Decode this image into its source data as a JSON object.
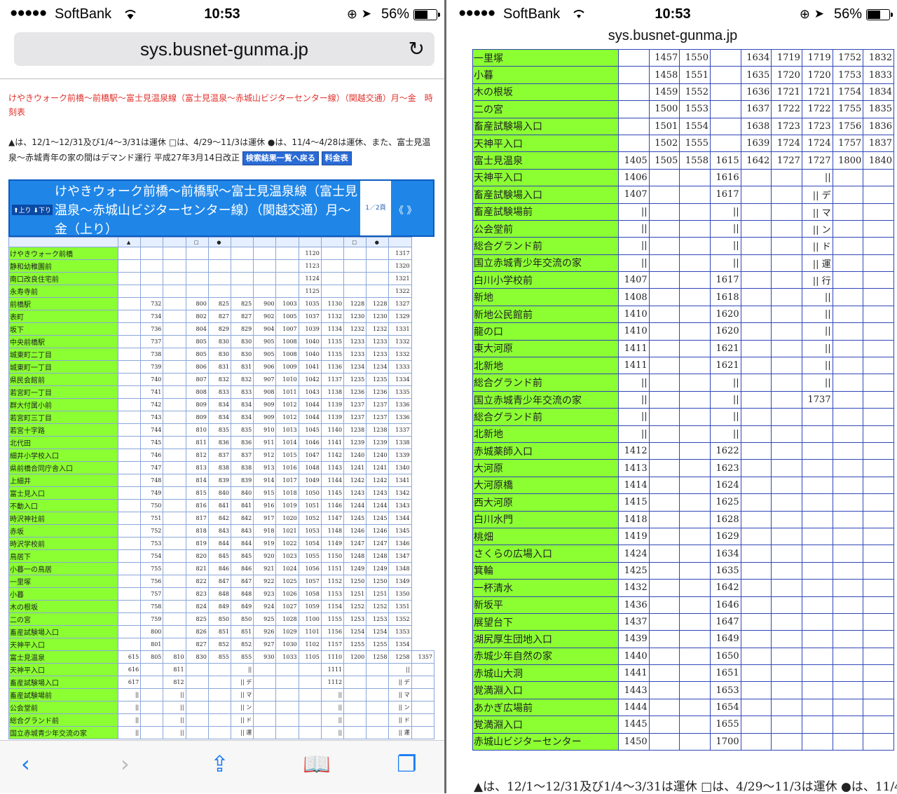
{
  "status": {
    "carrier": "SoftBank",
    "signal": "●●●●●",
    "time": "10:53",
    "battery": "56%"
  },
  "browser": {
    "url": "sys.busnet-gunma.jp"
  },
  "route_title": "けやきウォーク前橋〜前橋駅〜富士見温泉線（富士見温泉〜赤城山ビジターセンター線）（関越交通）月〜金　時刻表",
  "note_text": "▲は、12/1〜12/31及び1/4〜3/31は運休 □は、4/29〜11/3は運休 ●は、11/4〜4/28は運休、また、富士見温泉〜赤城青年の家の間はデマンド運行 平成27年3月14日改正",
  "buttons": {
    "back_results": "検索結果一覧へ戻る",
    "fare": "料金表"
  },
  "banner": {
    "up": "⬆上り",
    "down": "⬇下り",
    "title": "けやきウォーク前橋〜前橋駅〜富士見温泉線（富士見温泉〜赤城山ビジターセンター線）（関越交通）月〜金（上り）",
    "page": "1／2頁",
    "prev": "《",
    "next": "》"
  },
  "left_header": [
    "",
    "▲",
    "",
    "",
    "□",
    "●",
    "",
    "",
    "",
    "",
    "",
    "□",
    "●",
    ""
  ],
  "left_rows": [
    [
      "けやきウォーク前橋",
      "",
      "",
      "",
      "",
      "",
      "",
      "",
      "",
      "1120",
      "",
      "",
      "",
      "1317"
    ],
    [
      "静和幼稚園前",
      "",
      "",
      "",
      "",
      "",
      "",
      "",
      "",
      "1123",
      "",
      "",
      "",
      "1320"
    ],
    [
      "南口改良住宅前",
      "",
      "",
      "",
      "",
      "",
      "",
      "",
      "",
      "1124",
      "",
      "",
      "",
      "1321"
    ],
    [
      "永寿寺前",
      "",
      "",
      "",
      "",
      "",
      "",
      "",
      "",
      "1125",
      "",
      "",
      "",
      "1322"
    ],
    [
      "前橋駅",
      "",
      "732",
      "",
      "800",
      "825",
      "825",
      "900",
      "1003",
      "1035",
      "1130",
      "1228",
      "1228",
      "1327"
    ],
    [
      "表町",
      "",
      "734",
      "",
      "802",
      "827",
      "827",
      "902",
      "1005",
      "1037",
      "1132",
      "1230",
      "1230",
      "1329"
    ],
    [
      "坂下",
      "",
      "736",
      "",
      "804",
      "829",
      "829",
      "904",
      "1007",
      "1039",
      "1134",
      "1232",
      "1232",
      "1331"
    ],
    [
      "中央前橋駅",
      "",
      "737",
      "",
      "805",
      "830",
      "830",
      "905",
      "1008",
      "1040",
      "1135",
      "1233",
      "1233",
      "1332"
    ],
    [
      "城東町二丁目",
      "",
      "738",
      "",
      "805",
      "830",
      "830",
      "905",
      "1008",
      "1040",
      "1135",
      "1233",
      "1233",
      "1332"
    ],
    [
      "城東町一丁目",
      "",
      "739",
      "",
      "806",
      "831",
      "831",
      "906",
      "1009",
      "1041",
      "1136",
      "1234",
      "1234",
      "1333"
    ],
    [
      "県民会館前",
      "",
      "740",
      "",
      "807",
      "832",
      "832",
      "907",
      "1010",
      "1042",
      "1137",
      "1235",
      "1235",
      "1334"
    ],
    [
      "若宮町一丁目",
      "",
      "741",
      "",
      "808",
      "833",
      "833",
      "908",
      "1011",
      "1043",
      "1138",
      "1236",
      "1236",
      "1335"
    ],
    [
      "群大付属小前",
      "",
      "742",
      "",
      "809",
      "834",
      "834",
      "909",
      "1012",
      "1044",
      "1139",
      "1237",
      "1237",
      "1336"
    ],
    [
      "若宮町三丁目",
      "",
      "743",
      "",
      "809",
      "834",
      "834",
      "909",
      "1012",
      "1044",
      "1139",
      "1237",
      "1237",
      "1336"
    ],
    [
      "若宮十字路",
      "",
      "744",
      "",
      "810",
      "835",
      "835",
      "910",
      "1013",
      "1045",
      "1140",
      "1238",
      "1238",
      "1337"
    ],
    [
      "北代田",
      "",
      "745",
      "",
      "811",
      "836",
      "836",
      "911",
      "1014",
      "1046",
      "1141",
      "1239",
      "1239",
      "1338"
    ],
    [
      "細井小学校入口",
      "",
      "746",
      "",
      "812",
      "837",
      "837",
      "912",
      "1015",
      "1047",
      "1142",
      "1240",
      "1240",
      "1339"
    ],
    [
      "県前橋合同庁舎入口",
      "",
      "747",
      "",
      "813",
      "838",
      "838",
      "913",
      "1016",
      "1048",
      "1143",
      "1241",
      "1241",
      "1340"
    ],
    [
      "上細井",
      "",
      "748",
      "",
      "814",
      "839",
      "839",
      "914",
      "1017",
      "1049",
      "1144",
      "1242",
      "1242",
      "1341"
    ],
    [
      "富士見入口",
      "",
      "749",
      "",
      "815",
      "840",
      "840",
      "915",
      "1018",
      "1050",
      "1145",
      "1243",
      "1243",
      "1342"
    ],
    [
      "不動入口",
      "",
      "750",
      "",
      "816",
      "841",
      "841",
      "916",
      "1019",
      "1051",
      "1146",
      "1244",
      "1244",
      "1343"
    ],
    [
      "時沢神社前",
      "",
      "751",
      "",
      "817",
      "842",
      "842",
      "917",
      "1020",
      "1052",
      "1147",
      "1245",
      "1245",
      "1344"
    ],
    [
      "赤坂",
      "",
      "752",
      "",
      "818",
      "843",
      "843",
      "918",
      "1021",
      "1053",
      "1148",
      "1246",
      "1246",
      "1345"
    ],
    [
      "時沢学校前",
      "",
      "753",
      "",
      "819",
      "844",
      "844",
      "919",
      "1022",
      "1054",
      "1149",
      "1247",
      "1247",
      "1346"
    ],
    [
      "鳥居下",
      "",
      "754",
      "",
      "820",
      "845",
      "845",
      "920",
      "1023",
      "1055",
      "1150",
      "1248",
      "1248",
      "1347"
    ],
    [
      "小暮一の鳥居",
      "",
      "755",
      "",
      "821",
      "846",
      "846",
      "921",
      "1024",
      "1056",
      "1151",
      "1249",
      "1249",
      "1348"
    ],
    [
      "一里塚",
      "",
      "756",
      "",
      "822",
      "847",
      "847",
      "922",
      "1025",
      "1057",
      "1152",
      "1250",
      "1250",
      "1349"
    ],
    [
      "小暮",
      "",
      "757",
      "",
      "823",
      "848",
      "848",
      "923",
      "1026",
      "1058",
      "1153",
      "1251",
      "1251",
      "1350"
    ],
    [
      "木の根坂",
      "",
      "758",
      "",
      "824",
      "849",
      "849",
      "924",
      "1027",
      "1059",
      "1154",
      "1252",
      "1252",
      "1351"
    ],
    [
      "二の宮",
      "",
      "759",
      "",
      "825",
      "850",
      "850",
      "925",
      "1028",
      "1100",
      "1155",
      "1253",
      "1253",
      "1352"
    ],
    [
      "畜産試験場入口",
      "",
      "800",
      "",
      "826",
      "851",
      "851",
      "926",
      "1029",
      "1101",
      "1156",
      "1254",
      "1254",
      "1353"
    ],
    [
      "天神平入口",
      "",
      "801",
      "",
      "827",
      "852",
      "852",
      "927",
      "1030",
      "1102",
      "1157",
      "1255",
      "1255",
      "1354"
    ],
    [
      "富士見温泉",
      "615",
      "805",
      "810",
      "830",
      "855",
      "855",
      "930",
      "1033",
      "1105",
      "1110",
      "1200",
      "1258",
      "1258",
      "1357"
    ],
    [
      "天神平入口",
      "616",
      "",
      "811",
      "",
      "",
      "||",
      "",
      "",
      "",
      "1111",
      "",
      "",
      "||",
      ""
    ],
    [
      "畜産試験場入口",
      "617",
      "",
      "812",
      "",
      "",
      "|| デ",
      "",
      "",
      "",
      "1112",
      "",
      "",
      "|| デ",
      ""
    ],
    [
      "畜産試験場前",
      "||",
      "",
      "||",
      "",
      "",
      "|| マ",
      "",
      "",
      "",
      "||",
      "",
      "",
      "|| マ",
      ""
    ],
    [
      "公会堂前",
      "||",
      "",
      "||",
      "",
      "",
      "|| ン",
      "",
      "",
      "",
      "||",
      "",
      "",
      "|| ン",
      ""
    ],
    [
      "総合グランド前",
      "||",
      "",
      "||",
      "",
      "",
      "|| ド",
      "",
      "",
      "",
      "||",
      "",
      "",
      "|| ド",
      ""
    ],
    [
      "国立赤城青少年交流の家",
      "||",
      "",
      "||",
      "",
      "",
      "|| 運",
      "",
      "",
      "",
      "||",
      "",
      "",
      "|| 運",
      ""
    ]
  ],
  "right_rows": [
    [
      "一里塚",
      "",
      "1457",
      "1550",
      "",
      "1634",
      "1719",
      "1719",
      "1752",
      "1832"
    ],
    [
      "小暮",
      "",
      "1458",
      "1551",
      "",
      "1635",
      "1720",
      "1720",
      "1753",
      "1833"
    ],
    [
      "木の根坂",
      "",
      "1459",
      "1552",
      "",
      "1636",
      "1721",
      "1721",
      "1754",
      "1834"
    ],
    [
      "二の宮",
      "",
      "1500",
      "1553",
      "",
      "1637",
      "1722",
      "1722",
      "1755",
      "1835"
    ],
    [
      "畜産試験場入口",
      "",
      "1501",
      "1554",
      "",
      "1638",
      "1723",
      "1723",
      "1756",
      "1836"
    ],
    [
      "天神平入口",
      "",
      "1502",
      "1555",
      "",
      "1639",
      "1724",
      "1724",
      "1757",
      "1837"
    ],
    [
      "富士見温泉",
      "1405",
      "1505",
      "1558",
      "1615",
      "1642",
      "1727",
      "1727",
      "1800",
      "1840"
    ],
    [
      "天神平入口",
      "1406",
      "",
      "",
      "1616",
      "",
      "",
      "||",
      "",
      ""
    ],
    [
      "畜産試験場入口",
      "1407",
      "",
      "",
      "1617",
      "",
      "",
      "|| デ",
      "",
      ""
    ],
    [
      "畜産試験場前",
      "||",
      "",
      "",
      "||",
      "",
      "",
      "|| マ",
      "",
      ""
    ],
    [
      "公会堂前",
      "||",
      "",
      "",
      "||",
      "",
      "",
      "|| ン",
      "",
      ""
    ],
    [
      "総合グランド前",
      "||",
      "",
      "",
      "||",
      "",
      "",
      "|| ド",
      "",
      ""
    ],
    [
      "国立赤城青少年交流の家",
      "||",
      "",
      "",
      "||",
      "",
      "",
      "|| 運",
      "",
      ""
    ],
    [
      "白川小学校前",
      "1407",
      "",
      "",
      "1617",
      "",
      "",
      "|| 行",
      "",
      ""
    ],
    [
      "新地",
      "1408",
      "",
      "",
      "1618",
      "",
      "",
      "||",
      "",
      ""
    ],
    [
      "新地公民館前",
      "1410",
      "",
      "",
      "1620",
      "",
      "",
      "||",
      "",
      ""
    ],
    [
      "龍の口",
      "1410",
      "",
      "",
      "1620",
      "",
      "",
      "||",
      "",
      ""
    ],
    [
      "東大河原",
      "1411",
      "",
      "",
      "1621",
      "",
      "",
      "||",
      "",
      ""
    ],
    [
      "北新地",
      "1411",
      "",
      "",
      "1621",
      "",
      "",
      "||",
      "",
      ""
    ],
    [
      "総合グランド前",
      "||",
      "",
      "",
      "||",
      "",
      "",
      "||",
      "",
      ""
    ],
    [
      "国立赤城青少年交流の家",
      "||",
      "",
      "",
      "||",
      "",
      "",
      "1737",
      "",
      ""
    ],
    [
      "総合グランド前",
      "||",
      "",
      "",
      "||",
      "",
      "",
      "",
      "",
      ""
    ],
    [
      "北新地",
      "||",
      "",
      "",
      "||",
      "",
      "",
      "",
      "",
      ""
    ],
    [
      "赤城薬師入口",
      "1412",
      "",
      "",
      "1622",
      "",
      "",
      "",
      "",
      ""
    ],
    [
      "大河原",
      "1413",
      "",
      "",
      "1623",
      "",
      "",
      "",
      "",
      ""
    ],
    [
      "大河原橋",
      "1414",
      "",
      "",
      "1624",
      "",
      "",
      "",
      "",
      ""
    ],
    [
      "西大河原",
      "1415",
      "",
      "",
      "1625",
      "",
      "",
      "",
      "",
      ""
    ],
    [
      "白川水門",
      "1418",
      "",
      "",
      "1628",
      "",
      "",
      "",
      "",
      ""
    ],
    [
      "桃畑",
      "1419",
      "",
      "",
      "1629",
      "",
      "",
      "",
      "",
      ""
    ],
    [
      "さくらの広場入口",
      "1424",
      "",
      "",
      "1634",
      "",
      "",
      "",
      "",
      ""
    ],
    [
      "箕輪",
      "1425",
      "",
      "",
      "1635",
      "",
      "",
      "",
      "",
      ""
    ],
    [
      "一杯清水",
      "1432",
      "",
      "",
      "1642",
      "",
      "",
      "",
      "",
      ""
    ],
    [
      "新坂平",
      "1436",
      "",
      "",
      "1646",
      "",
      "",
      "",
      "",
      ""
    ],
    [
      "展望台下",
      "1437",
      "",
      "",
      "1647",
      "",
      "",
      "",
      "",
      ""
    ],
    [
      "湖尻厚生団地入口",
      "1439",
      "",
      "",
      "1649",
      "",
      "",
      "",
      "",
      ""
    ],
    [
      "赤城少年自然の家",
      "1440",
      "",
      "",
      "1650",
      "",
      "",
      "",
      "",
      ""
    ],
    [
      "赤城山大洞",
      "1441",
      "",
      "",
      "1651",
      "",
      "",
      "",
      "",
      ""
    ],
    [
      "覚満淵入口",
      "1443",
      "",
      "",
      "1653",
      "",
      "",
      "",
      "",
      ""
    ],
    [
      "あかぎ広場前",
      "1444",
      "",
      "",
      "1654",
      "",
      "",
      "",
      "",
      ""
    ],
    [
      "覚満淵入口",
      "1445",
      "",
      "",
      "1655",
      "",
      "",
      "",
      "",
      ""
    ],
    [
      "赤城山ビジターセンター",
      "1450",
      "",
      "",
      "1700",
      "",
      "",
      "",
      "",
      ""
    ]
  ],
  "right_bottom_note": "▲は、12/1〜12/31及び1/4〜3/31は運休 □は、4/29〜11/3は運休 ●は、11/4"
}
